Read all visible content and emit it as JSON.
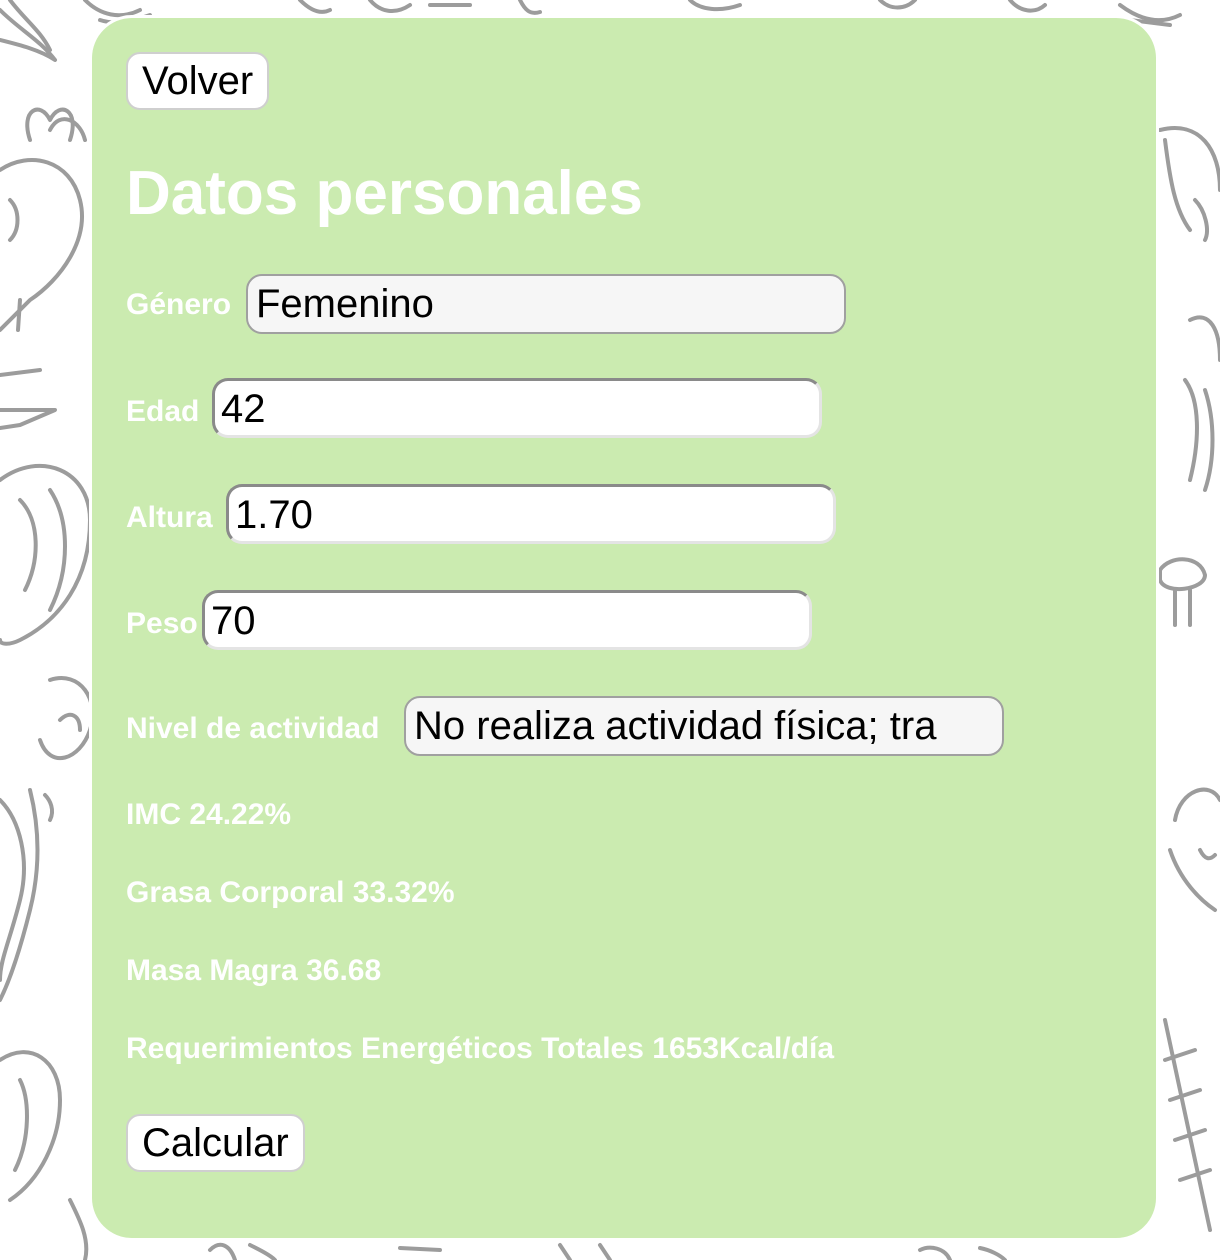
{
  "nav": {
    "back_label": "Volver"
  },
  "form": {
    "title": "Datos personales",
    "gender": {
      "label": "Género",
      "value": "Femenino"
    },
    "age": {
      "label": "Edad",
      "value": "42"
    },
    "height": {
      "label": "Altura",
      "value": "1.70"
    },
    "weight": {
      "label": "Peso",
      "value": "70"
    },
    "activity": {
      "label": "Nivel de actividad",
      "value": "No realiza actividad física; tra"
    },
    "submit_label": "Calcular"
  },
  "results": {
    "imc": {
      "label": "IMC",
      "value": "24.22%"
    },
    "body_fat": {
      "label": "Grasa Corporal",
      "value": "33.32%"
    },
    "lean_mass": {
      "label": "Masa Magra",
      "value": "36.68"
    },
    "energy": {
      "label": "Requerimientos Energéticos Totales",
      "value": "1653Kcal/día"
    }
  },
  "colors": {
    "card_background": "#cbebb0",
    "text_light": "#ffffff",
    "doodle_stroke": "#9c9c9c"
  },
  "background": {
    "pattern_icons": [
      "radish-icon",
      "lettuce-icon",
      "asparagus-icon",
      "mushroom-icon",
      "broccoli-icon",
      "carrot-icon",
      "pepper-icon",
      "cabbage-icon"
    ]
  }
}
